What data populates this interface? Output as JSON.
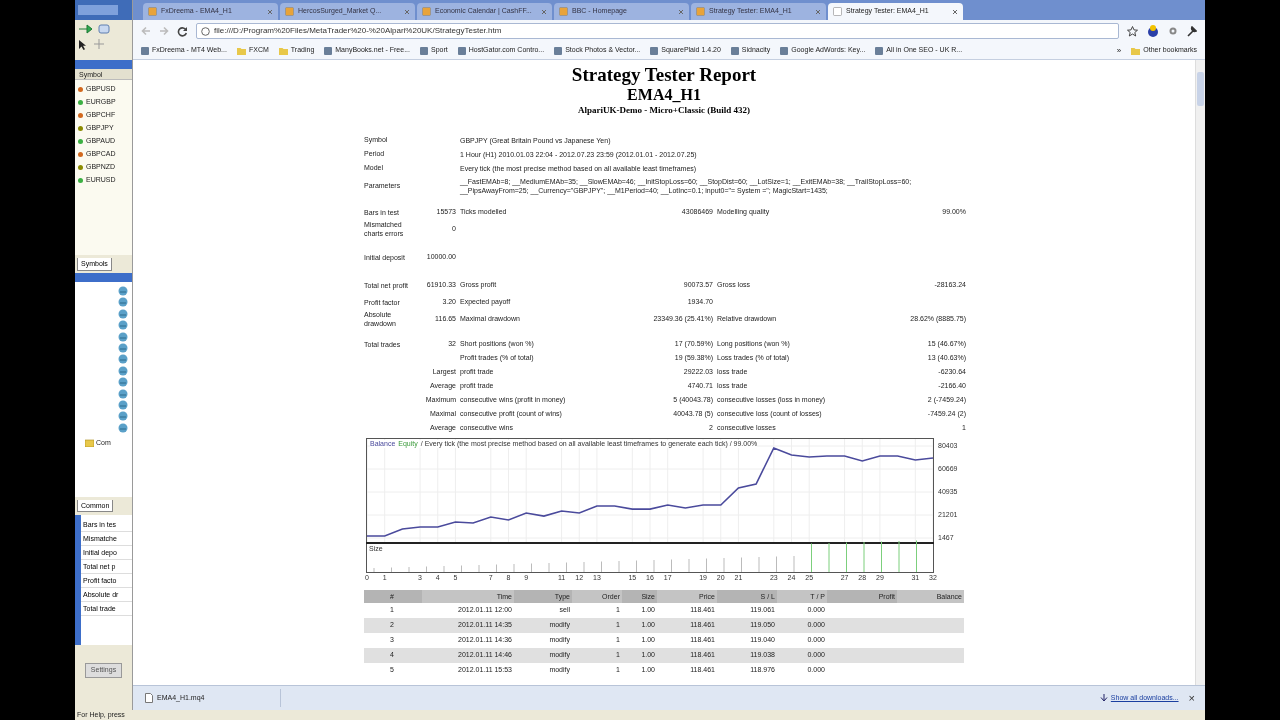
{
  "terminal": {
    "symbols_header": "Symbol",
    "symbols": [
      {
        "name": "GBPUSD",
        "color": "#d2691e"
      },
      {
        "name": "EURGBP",
        "color": "#3cb043"
      },
      {
        "name": "GBPCHF",
        "color": "#d2691e"
      },
      {
        "name": "GBPJPY",
        "color": "#8b8b00"
      },
      {
        "name": "GBPAUD",
        "color": "#3cb043"
      },
      {
        "name": "GBPCAD",
        "color": "#d2691e"
      },
      {
        "name": "GBPNZD",
        "color": "#8b8b00"
      },
      {
        "name": "EURUSD",
        "color": "#3cb043"
      }
    ],
    "symbols_tab": "Symbols",
    "navigator_folder": "Com",
    "navigator_tab": "Common",
    "tester_rows": [
      "Bars in tes",
      "Mismatche",
      "Initial depo",
      "Total net p",
      "Profit facto",
      "Absolute dr",
      "Total trade"
    ],
    "settings_button": "Settings",
    "status": "For Help, press"
  },
  "browser": {
    "tabs": [
      {
        "title": "FxDreema - EMA4_H1",
        "selected": false
      },
      {
        "title": "HercosSurged_Market Q...",
        "selected": false
      },
      {
        "title": "Economic Calendar | CashFF...",
        "selected": false
      },
      {
        "title": "BBC - Homepage",
        "selected": false
      },
      {
        "title": "Strategy Tester: EMA4_H1",
        "selected": false
      },
      {
        "title": "Strategy Tester: EMA4_H1",
        "selected": true
      }
    ],
    "url": "file:///D:/Program%20Files/MetaTrader%20-%20Alpari%20UK/StrategyTester.htm",
    "bookmarks": [
      {
        "label": "FxDreema - MT4 Web...",
        "kind": "page"
      },
      {
        "label": "FXCM",
        "kind": "folder"
      },
      {
        "label": "Trading",
        "kind": "folder"
      },
      {
        "label": "ManyBooks.net - Free...",
        "kind": "page"
      },
      {
        "label": "Sport",
        "kind": "page"
      },
      {
        "label": "HostGator.com Contro...",
        "kind": "page"
      },
      {
        "label": "Stock Photos & Vector...",
        "kind": "page"
      },
      {
        "label": "SquarePlaid 1.4.20",
        "kind": "page"
      },
      {
        "label": "Sidnacity",
        "kind": "page"
      },
      {
        "label": "Google AdWords: Key...",
        "kind": "page"
      },
      {
        "label": "All in One SEO - UK R...",
        "kind": "page"
      }
    ],
    "bookmarks_more": "»",
    "other_bookmarks": "Other bookmarks",
    "download": {
      "file": "EMA4_H1.mq4",
      "show_all": "Show all downloads...",
      "close": "×"
    }
  },
  "report": {
    "title": "Strategy Tester Report",
    "expert": "EMA4_H1",
    "server": "AlpariUK-Demo - Micro+Classic (Build 432)",
    "summary": [
      [
        {
          "kind": "field",
          "label": "Symbol",
          "text": "GBPJPY (Great Britain Pound vs Japanese Yen)"
        },
        {
          "kind": "field",
          "label": "Period",
          "text": "1 Hour (H1) 2010.01.03 22:04 - 2012.07.23 23:59 (2012.01.01 - 2012.07.25)"
        },
        {
          "kind": "field",
          "label": "Model",
          "text": "Every tick (the most precise method based on all available least timeframes)"
        },
        {
          "kind": "field",
          "label": "Parameters",
          "text": "__FastEMAb=8; __MediumEMAb=35; __SlowEMAb=46; __InitStopLoss=60; __StopDist=60; __LotSize=1; __ExitEMAb=38; __TrailStopLoss=60; __PipsAwayFrom=25; __Currency=\"GBPJPY\"; __M1Period=40; __LotInc=0.1; input0=\"= System =\"; MagicStart=1435;"
        }
      ],
      [
        {
          "kind": "stats",
          "label": "Bars in test",
          "value": "15573",
          "label_2": "Ticks modelled",
          "value_2": "43086469",
          "label_3": "Modelling quality",
          "value_3": "99.00%"
        },
        {
          "kind": "stats",
          "label": "Mismatched charts errors",
          "value": "0"
        }
      ],
      [
        {
          "kind": "stats",
          "label": "Initial deposit",
          "value": "10000.00"
        }
      ],
      [
        {
          "kind": "stats",
          "label": "Total net profit",
          "value": "61910.33",
          "label_2": "Gross profit",
          "value_2": "90073.57",
          "label_3": "Gross loss",
          "value_3": "-28163.24"
        },
        {
          "kind": "stats",
          "label": "Profit factor",
          "value": "3.20",
          "label_2": "Expected payoff",
          "value_2": "1934.70"
        },
        {
          "kind": "stats",
          "label": "Absolute drawdown",
          "value": "116.65",
          "label_2": "Maximal drawdown",
          "value_2": "23349.36 (25.41%)",
          "label_3": "Relative drawdown",
          "value_3": "28.62% (8885.75)"
        }
      ],
      [
        {
          "kind": "stats",
          "label": "Total trades",
          "value": "32",
          "label_2": "Short positions (won %)",
          "value_2": "17 (70.59%)",
          "label_3": "Long positions (won %)",
          "value_3": "15 (46.67%)"
        },
        {
          "kind": "sub",
          "label_2": "Profit trades (% of total)",
          "value_2": "19 (59.38%)",
          "label_3": "Loss trades (% of total)",
          "value_3": "13 (40.63%)"
        },
        {
          "kind": "sub",
          "label": "Largest",
          "label_2": "profit trade",
          "value_2": "29222.03",
          "label_3": "loss trade",
          "value_3": "-6230.64"
        },
        {
          "kind": "sub",
          "label": "Average",
          "label_2": "profit trade",
          "value_2": "4740.71",
          "label_3": "loss trade",
          "value_3": "-2166.40"
        },
        {
          "kind": "sub",
          "label": "Maximum",
          "label_2": "consecutive wins (profit in money)",
          "value_2": "5 (40043.78)",
          "label_3": "consecutive losses (loss in money)",
          "value_3": "2 (-7459.24)"
        },
        {
          "kind": "sub",
          "label": "Maximal",
          "label_2": "consecutive profit (count of wins)",
          "value_2": "40043.78 (5)",
          "label_3": "consecutive loss (count of losses)",
          "value_3": "-7459.24 (2)"
        },
        {
          "kind": "sub",
          "label": "Average",
          "label_2": "consecutive wins",
          "value_2": "2",
          "label_3": "consecutive losses",
          "value_3": "1"
        }
      ]
    ],
    "chart": {
      "legend_equity": "Equity",
      "legend_text": "/ Every tick (the most precise method based on all available least timeframes to generate each tick) / 99.00%",
      "volume_label": "Size",
      "chart_data": {
        "type": "line",
        "x": [
          0,
          1,
          2,
          3,
          4,
          5,
          6,
          7,
          8,
          9,
          10,
          11,
          12,
          13,
          14,
          15,
          16,
          17,
          18,
          19,
          20,
          21,
          22,
          23,
          24,
          25,
          26,
          27,
          28,
          29,
          30,
          31,
          32
        ],
        "series": [
          {
            "name": "Balance",
            "color": "#4a4a9c",
            "values": [
              3200,
              3200,
              9200,
              10900,
              10900,
              15200,
              14300,
              19500,
              16900,
              22900,
              20300,
              24600,
              22900,
              28900,
              28900,
              26300,
              26300,
              29800,
              27200,
              29800,
              29800,
              44400,
              47800,
              78700,
              72700,
              71000,
              71800,
              71800,
              67500,
              71800,
              71800,
              68400,
              70100
            ]
          }
        ],
        "xlim": [
          0,
          32
        ],
        "ylim": [
          1467,
          80403
        ],
        "xticks": [
          0,
          1,
          3,
          4,
          5,
          7,
          8,
          9,
          11,
          12,
          13,
          15,
          16,
          17,
          19,
          20,
          21,
          23,
          24,
          25,
          27,
          28,
          29,
          31,
          32
        ],
        "yticks": [
          80403,
          60669,
          40935,
          21201,
          1467
        ],
        "grid": true
      }
    },
    "table": {
      "columns": [
        "#",
        "Time",
        "Type",
        "Order",
        "Size",
        "Price",
        "S / L",
        "T / P",
        "Profit",
        "Balance"
      ],
      "rows": [
        [
          "1",
          "2012.01.11 12:00",
          "sell",
          "1",
          "1.00",
          "118.461",
          "119.061",
          "0.000"
        ],
        [
          "2",
          "2012.01.11 14:35",
          "modify",
          "1",
          "1.00",
          "118.461",
          "119.050",
          "0.000"
        ],
        [
          "3",
          "2012.01.11 14:36",
          "modify",
          "1",
          "1.00",
          "118.461",
          "119.040",
          "0.000"
        ],
        [
          "4",
          "2012.01.11 14:46",
          "modify",
          "1",
          "1.00",
          "118.461",
          "119.038",
          "0.000"
        ],
        [
          "5",
          "2012.01.11 15:53",
          "modify",
          "1",
          "1.00",
          "118.461",
          "118.976",
          "0.000"
        ]
      ]
    }
  }
}
